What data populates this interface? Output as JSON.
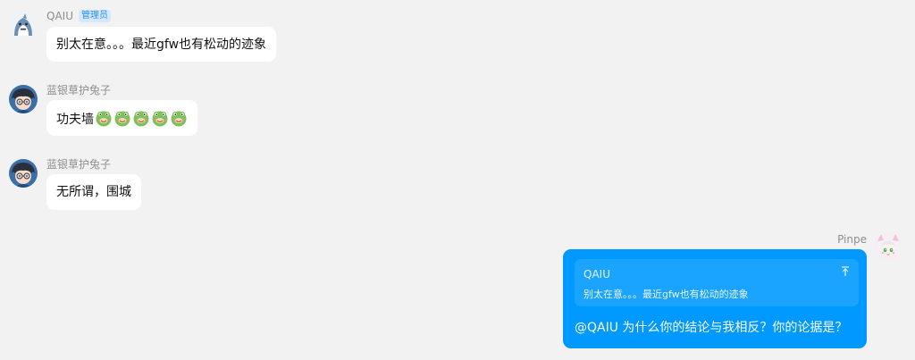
{
  "messages": [
    {
      "sender": "QAIU",
      "badge": "管理员",
      "text": "别太在意。。。最近gfw也有松动的迹象",
      "avatar_icon": "shark-avatar"
    },
    {
      "sender": "蓝银草护兔子",
      "text": "功夫墙",
      "emojis": [
        "frog-face-emoji",
        "frog-face-emoji",
        "frog-face-emoji",
        "frog-face-emoji",
        "frog-face-emoji"
      ],
      "avatar_icon": "anime-boy-avatar"
    },
    {
      "sender": "蓝银草护兔子",
      "text": "无所谓，围城",
      "avatar_icon": "anime-boy-avatar"
    },
    {
      "sender": "Pinpe",
      "avatar_icon": "anime-girl-avatar",
      "quote": {
        "author": "QAIU",
        "text": "别太在意。。。最近gfw也有松动的迹象",
        "jump_icon": "jump-to-message-icon"
      },
      "text": "@QAIU 为什么你的结论与我相反？你的论据是？"
    }
  ],
  "colors": {
    "background": "#f2f2f2",
    "self_bubble": "#0099ff",
    "other_bubble": "#ffffff",
    "badge_text": "#2c8ef2",
    "badge_bg": "#d6e9fc"
  }
}
